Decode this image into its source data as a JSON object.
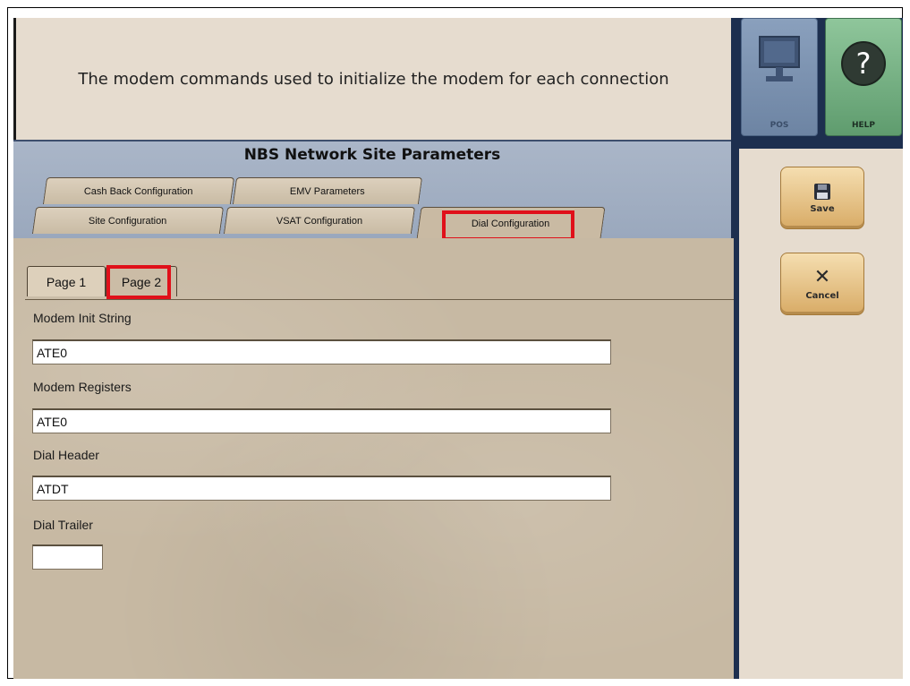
{
  "banner": {
    "description": "The modem commands used to initialize the modem for each connection"
  },
  "toolbar": {
    "pos_label": "POS",
    "help_label": "HELP",
    "help_symbol": "?"
  },
  "actions": {
    "save_label": "Save",
    "cancel_label": "Cancel",
    "cancel_symbol": "✕"
  },
  "main": {
    "title": "NBS Network Site Parameters",
    "tabs_back_row": [
      {
        "label": "Cash Back Configuration"
      },
      {
        "label": "EMV Parameters"
      }
    ],
    "tabs_front_row": [
      {
        "label": "Site Configuration"
      },
      {
        "label": "VSAT Configuration"
      },
      {
        "label": "Dial Configuration",
        "active": true
      }
    ],
    "subtabs": [
      {
        "label": "Page 1"
      },
      {
        "label": "Page 2",
        "active": true
      }
    ],
    "fields": [
      {
        "label": "Modem Init String",
        "value": "ATE0"
      },
      {
        "label": "Modem Registers",
        "value": "ATE0"
      },
      {
        "label": "Dial Header",
        "value": "ATDT"
      },
      {
        "label": "Dial Trailer",
        "value": ""
      }
    ]
  },
  "colors": {
    "highlight": "#e0101a",
    "right_panel": "#1d2f4f",
    "panel_bg": "#e6dccf"
  }
}
